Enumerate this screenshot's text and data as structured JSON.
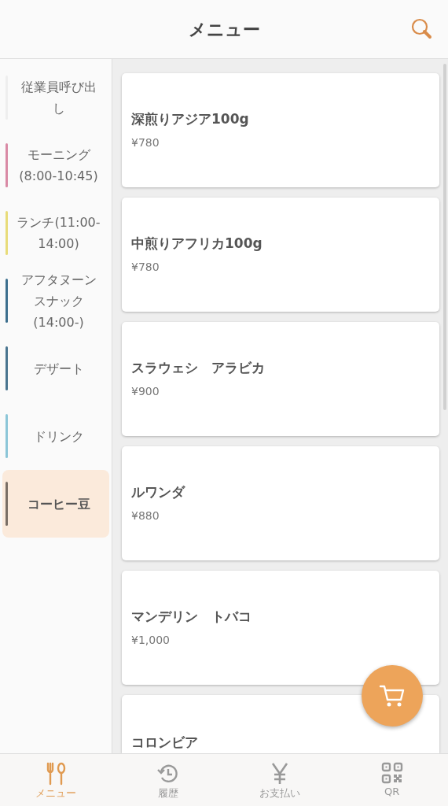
{
  "header": {
    "title": "メニュー"
  },
  "categories": [
    {
      "label": "従業員呼び出し",
      "color": "#eeeeee",
      "selected": false
    },
    {
      "label": "モーニング(8:00-10:45)",
      "color": "#d98aa5",
      "selected": false
    },
    {
      "label": "ランチ(11:00-14:00)",
      "color": "#e8dc7a",
      "selected": false
    },
    {
      "label": "アフタヌーンスナック(14:00-)",
      "color": "#3d6f8e",
      "selected": false
    },
    {
      "label": "デザート",
      "color": "#4a7590",
      "selected": false
    },
    {
      "label": "ドリンク",
      "color": "#8cc6d8",
      "selected": false
    },
    {
      "label": "コーヒー豆",
      "color": "#7a6f66",
      "selected": true
    }
  ],
  "products": [
    {
      "name": "深煎りアジア100g",
      "price": "¥780"
    },
    {
      "name": "中煎りアフリカ100g",
      "price": "¥780"
    },
    {
      "name": "スラウェシ　アラビカ",
      "price": "¥900"
    },
    {
      "name": "ルワンダ",
      "price": "¥880"
    },
    {
      "name": "マンデリン　トバコ",
      "price": "¥1,000"
    },
    {
      "name": "コロンビア"
    }
  ],
  "tabs": [
    {
      "kind": "menu",
      "label": "メニュー",
      "selected": true
    },
    {
      "kind": "history",
      "label": "履歴",
      "selected": false
    },
    {
      "kind": "payment",
      "label": "お支払い",
      "selected": false
    },
    {
      "kind": "qr",
      "label": "QR",
      "selected": false
    }
  ]
}
